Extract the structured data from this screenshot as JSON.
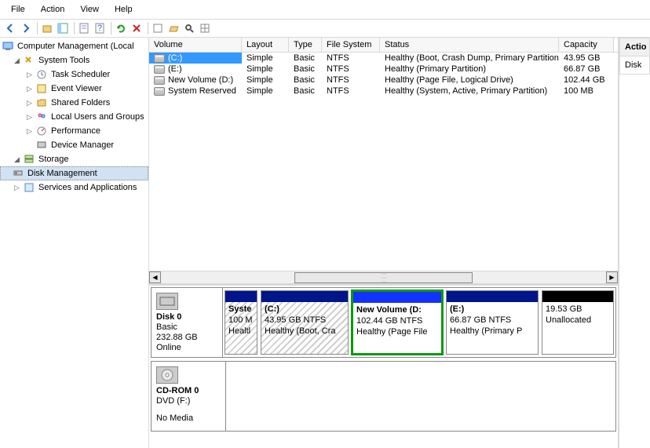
{
  "menu": {
    "file": "File",
    "action": "Action",
    "view": "View",
    "help": "Help"
  },
  "tree": {
    "root": "Computer Management (Local",
    "system_tools": "System Tools",
    "task_scheduler": "Task Scheduler",
    "event_viewer": "Event Viewer",
    "shared_folders": "Shared Folders",
    "local_users": "Local Users and Groups",
    "performance": "Performance",
    "device_manager": "Device Manager",
    "storage": "Storage",
    "disk_management": "Disk Management",
    "services": "Services and Applications"
  },
  "volumes": {
    "headers": {
      "volume": "Volume",
      "layout": "Layout",
      "type": "Type",
      "fs": "File System",
      "status": "Status",
      "capacity": "Capacity"
    },
    "rows": [
      {
        "name": "(C:)",
        "layout": "Simple",
        "type": "Basic",
        "fs": "NTFS",
        "status": "Healthy (Boot, Crash Dump, Primary Partition)",
        "capacity": "43.95 GB"
      },
      {
        "name": "(E:)",
        "layout": "Simple",
        "type": "Basic",
        "fs": "NTFS",
        "status": "Healthy (Primary Partition)",
        "capacity": "66.87 GB"
      },
      {
        "name": "New Volume (D:)",
        "layout": "Simple",
        "type": "Basic",
        "fs": "NTFS",
        "status": "Healthy (Page File, Logical Drive)",
        "capacity": "102.44 GB"
      },
      {
        "name": "System Reserved",
        "layout": "Simple",
        "type": "Basic",
        "fs": "NTFS",
        "status": "Healthy (System, Active, Primary Partition)",
        "capacity": "100 MB"
      }
    ]
  },
  "disks": {
    "d0": {
      "name": "Disk 0",
      "type": "Basic",
      "size": "232.88 GB",
      "status": "Online",
      "parts": [
        {
          "name": "Syste",
          "size": "100 M",
          "health": "Healtl"
        },
        {
          "name": "(C:)",
          "size": "43.95 GB NTFS",
          "health": "Healthy (Boot, Cra"
        },
        {
          "name": "New Volume  (D:",
          "size": "102.44 GB NTFS",
          "health": "Healthy (Page File"
        },
        {
          "name": "(E:)",
          "size": "66.87 GB NTFS",
          "health": "Healthy (Primary P"
        },
        {
          "name": "",
          "size": "19.53 GB",
          "health": "Unallocated"
        }
      ]
    },
    "cd": {
      "name": "CD-ROM 0",
      "type": "DVD (F:)",
      "nomedia": "No Media"
    }
  },
  "actions": {
    "title": "Actio",
    "item": "Disk"
  }
}
